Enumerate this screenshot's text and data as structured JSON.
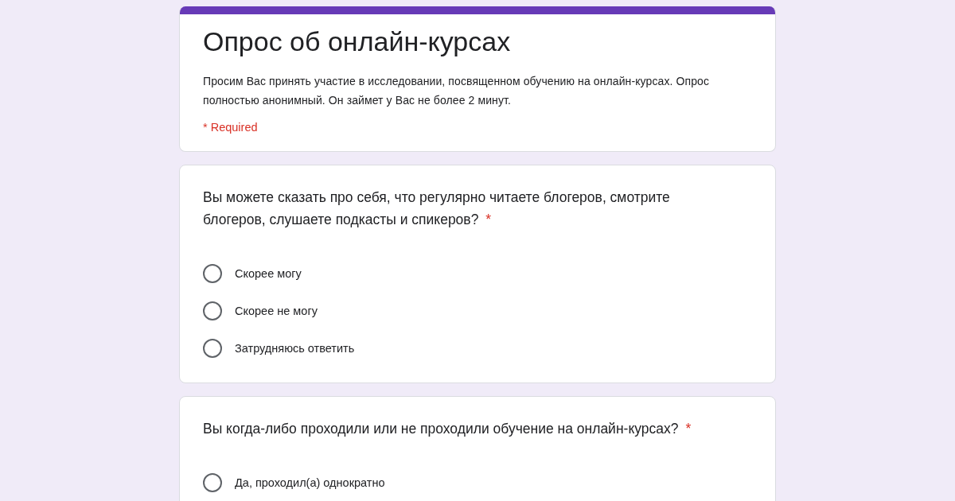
{
  "form": {
    "title": "Опрос об онлайн-курсах",
    "description": "Просим Вас принять участие в исследовании, посвященном обучению на онлайн-курсах. Опрос полностью анонимный. Он займет у Вас не более 2 минут.",
    "required_note": "* Required"
  },
  "questions": [
    {
      "text": "Вы можете сказать про себя, что регулярно читаете блогеров, смотрите блогеров, слушаете подкасты и спикеров?",
      "required_mark": "*",
      "options": [
        {
          "label": "Скорее могу",
          "selected": false
        },
        {
          "label": "Скорее не могу",
          "selected": false
        },
        {
          "label": "Затрудняюсь ответить",
          "selected": false
        }
      ]
    },
    {
      "text": "Вы когда-либо проходили или не проходили обучение на онлайн-курсах?",
      "required_mark": "*",
      "options": [
        {
          "label": "Да, проходил(а) однократно",
          "selected": false
        }
      ]
    }
  ]
}
